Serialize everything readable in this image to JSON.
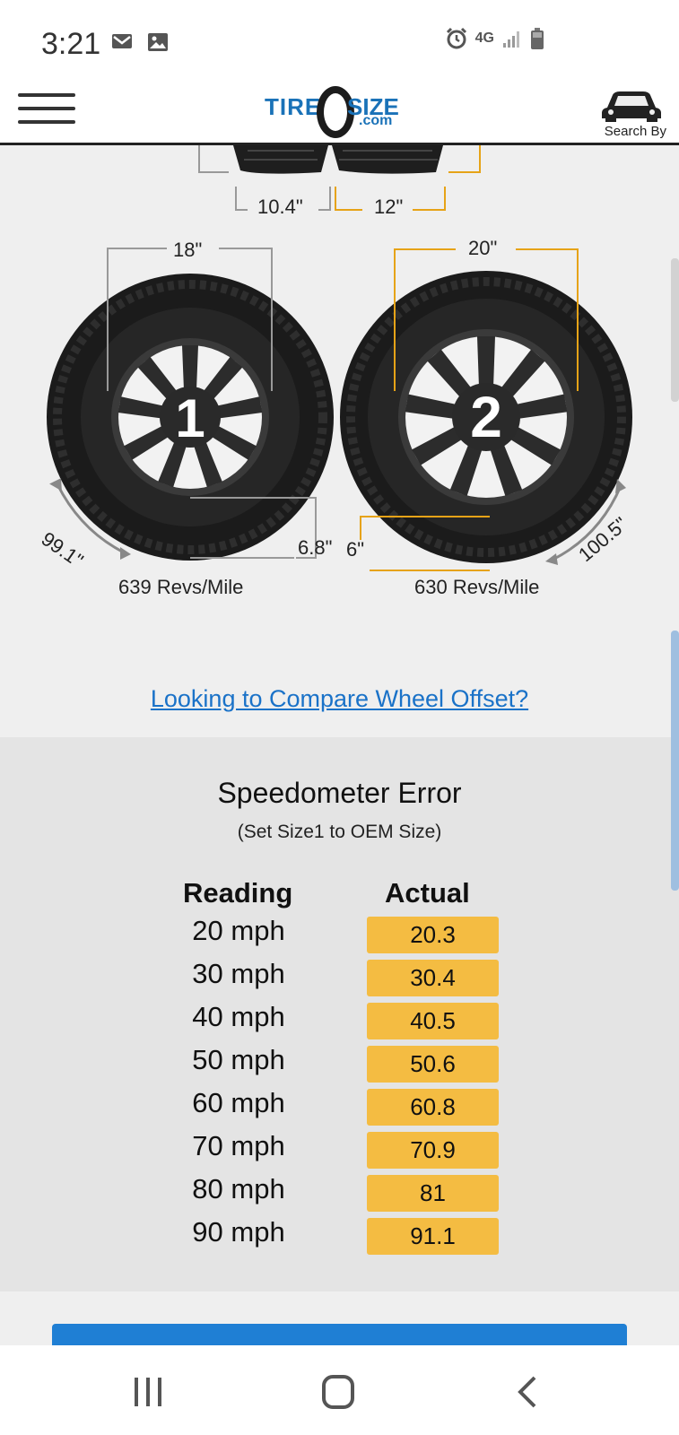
{
  "status_bar": {
    "time": "3:21",
    "network": "4G",
    "icons": [
      "gmail-icon",
      "gallery-icon",
      "alarm-icon",
      "network-4g-icon",
      "signal-icon",
      "battery-icon"
    ]
  },
  "header": {
    "logo_tire": "TIRE",
    "logo_size": "SIZE",
    "logo_com": ".com",
    "search_by_label": "Search By"
  },
  "comparison": {
    "tread_width_1": "10.4\"",
    "tread_width_2": "12\"",
    "tire1": {
      "number": "1",
      "rim_diameter": "18\"",
      "sidewall": "6.8\"",
      "circumference": "99.1\"",
      "revs": "639 Revs/Mile"
    },
    "tire2": {
      "number": "2",
      "rim_diameter": "20\"",
      "sidewall": "6\"",
      "circumference": "100.5\"",
      "revs": "630 Revs/Mile"
    }
  },
  "offset_link": "Looking to Compare Wheel Offset?",
  "speedometer": {
    "title": "Speedometer Error",
    "subtitle": "(Set Size1 to OEM Size)",
    "col_reading": "Reading",
    "col_actual": "Actual",
    "rows": [
      {
        "reading": "20 mph",
        "actual": "20.3"
      },
      {
        "reading": "30 mph",
        "actual": "30.4"
      },
      {
        "reading": "40 mph",
        "actual": "40.5"
      },
      {
        "reading": "50 mph",
        "actual": "50.6"
      },
      {
        "reading": "60 mph",
        "actual": "60.8"
      },
      {
        "reading": "70 mph",
        "actual": "70.9"
      },
      {
        "reading": "80 mph",
        "actual": "81"
      },
      {
        "reading": "90 mph",
        "actual": "91.1"
      }
    ]
  },
  "colors": {
    "accent_orange": "#f4bc42",
    "link_blue": "#1a72c8",
    "tire2_line": "#e6a317",
    "tire1_line": "#999999"
  }
}
